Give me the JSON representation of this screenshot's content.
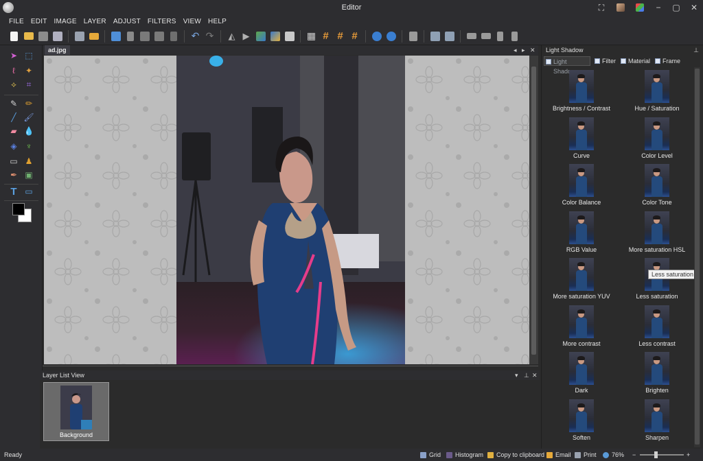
{
  "window": {
    "title": "Editor",
    "fullscreen_icon": "fullscreen-icon",
    "minimize": "−",
    "maximize": "▢",
    "close": "✕"
  },
  "menu": [
    "FILE",
    "EDIT",
    "IMAGE",
    "LAYER",
    "ADJUST",
    "FILTERS",
    "VIEW",
    "HELP"
  ],
  "toolbar": {
    "icons": [
      "new-file",
      "open-folder",
      "save",
      "save-as",
      "print",
      "email",
      "copy",
      "cut",
      "paste-small",
      "paste",
      "delete",
      "undo",
      "redo",
      "flip-horizontal",
      "flip-vertical",
      "rotate-left",
      "rotate-right",
      "skew",
      "grid-small",
      "grid-hash",
      "grid-hash-alt",
      "grid-hash-2",
      "zoom-in",
      "zoom-out",
      "select-arrow",
      "crop-fit",
      "crop-fill",
      "align-left",
      "align-right",
      "align-top",
      "align-bottom"
    ]
  },
  "left_tools": {
    "colors": {
      "foreground": "#000000",
      "background": "#ffffff"
    }
  },
  "document": {
    "tab_label": "ad.jpg",
    "nav_prev": "◂",
    "nav_next": "▸",
    "close": "✕"
  },
  "layer_panel": {
    "title": "Layer List View",
    "dropdown": "▾",
    "pin": "⊥",
    "close": "✕",
    "layers": [
      {
        "name": "Background"
      }
    ]
  },
  "right_panel": {
    "title": "Light Shadow",
    "pin": "⊥",
    "tabs": [
      "Light Shadow",
      "Filter",
      "Material",
      "Frame"
    ],
    "active_tab": "Light Shadow",
    "effects": [
      "Brightness / Contrast",
      "Hue / Saturation",
      "Curve",
      "Color Level",
      "Color Balance",
      "Color Tone",
      "RGB Value",
      "More saturation HSL",
      "More saturation YUV",
      "Less saturation",
      "More contrast",
      "Less contrast",
      "Dark",
      "Brighten",
      "Soften",
      "Sharpen"
    ],
    "tooltip": "Less saturation"
  },
  "status": {
    "text": "Ready",
    "grid": "Grid",
    "histogram": "Histogram",
    "copy": "Copy to clipboard",
    "email": "Email",
    "print": "Print",
    "zoom": "76%",
    "zoom_minus": "−",
    "zoom_plus": "+"
  }
}
